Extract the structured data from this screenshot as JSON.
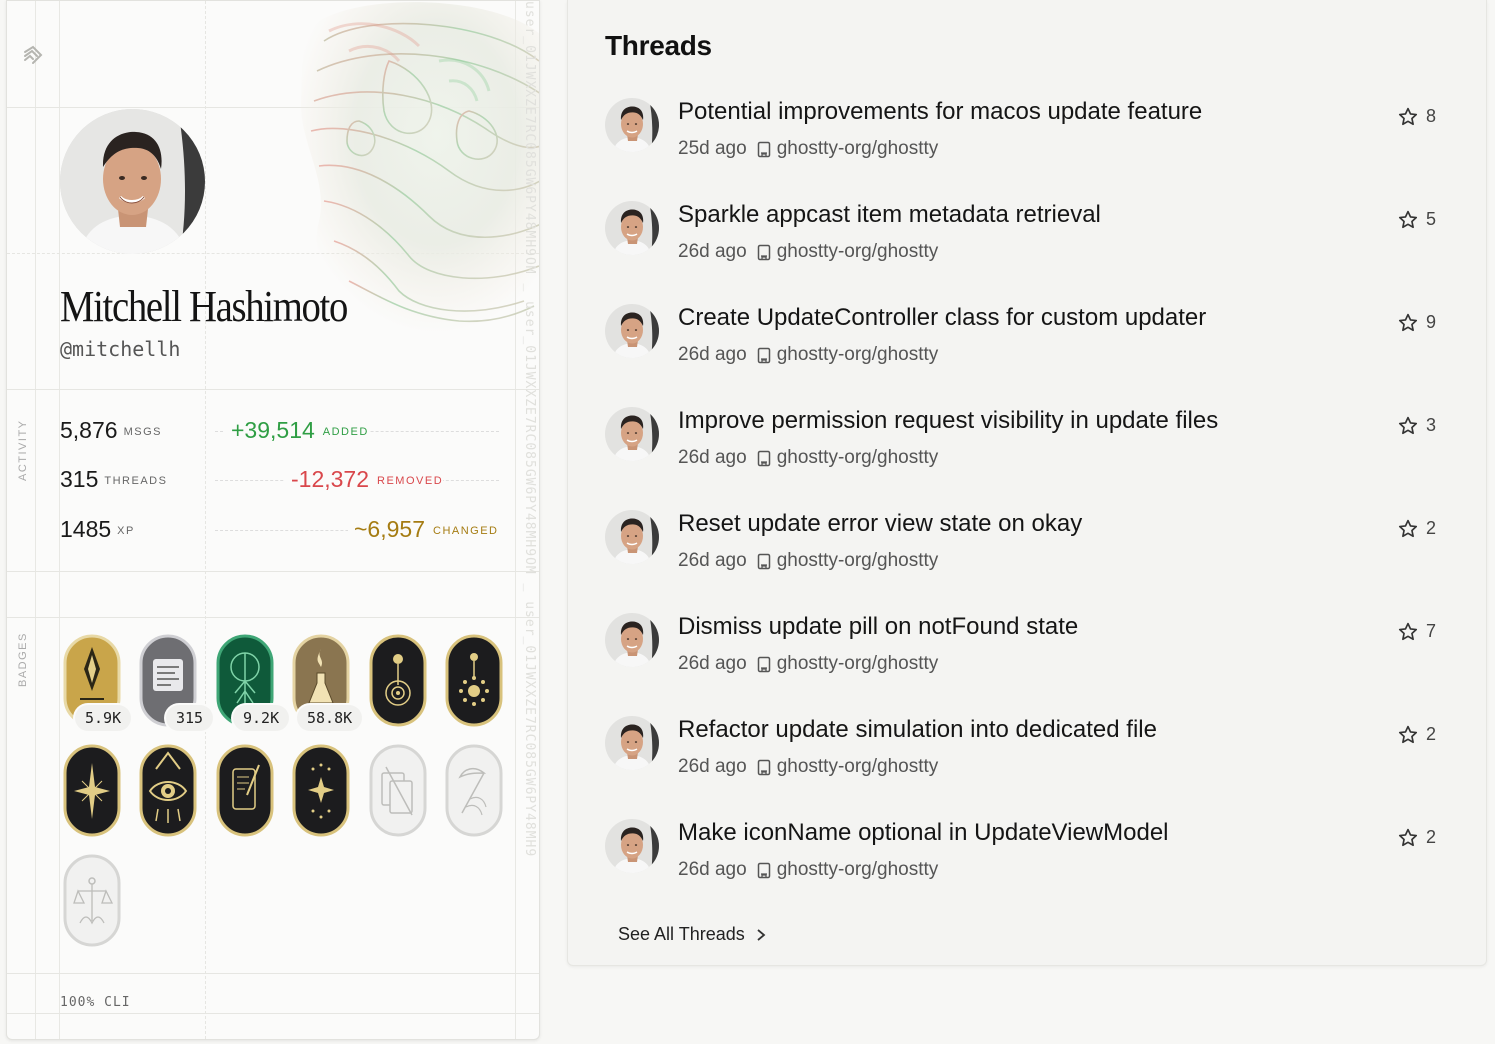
{
  "profile": {
    "name": "Mitchell Hashimoto",
    "handle": "@mitchellh",
    "user_id_text": "user_01JWXXZE7RC085GW6PY48MH9OM _ user_01JWXXZE7RC085GW6PY48MH9OM _ user_01JWXXZE7RC085GW6PY48MH9",
    "sections": {
      "activity": "ACTIVITY",
      "badges": "BADGES"
    },
    "stats": {
      "msgs": {
        "value": "5,876",
        "unit": "MSGS"
      },
      "threads": {
        "value": "315",
        "unit": "THREADS"
      },
      "xp": {
        "value": "1485",
        "unit": "XP"
      },
      "added": {
        "value": "+39,514",
        "unit": "ADDED",
        "color": "#2f9e44"
      },
      "removed": {
        "value": "-12,372",
        "unit": "REMOVED",
        "color": "#d9474b"
      },
      "changed": {
        "value": "~6,957",
        "unit": "CHANGED",
        "color": "#a57c12"
      }
    },
    "badges": [
      {
        "icon": "gold-quill-badge-icon",
        "count": "5.9K"
      },
      {
        "icon": "silver-terminal-badge-icon",
        "count": "315"
      },
      {
        "icon": "green-tree-badge-icon",
        "count": "9.2K"
      },
      {
        "icon": "gold-flask-badge-icon",
        "count": "58.8K"
      },
      {
        "icon": "black-orbit-badge-icon",
        "count": ""
      },
      {
        "icon": "black-sun-badge-icon",
        "count": ""
      },
      {
        "icon": "black-star-badge-icon",
        "count": ""
      },
      {
        "icon": "black-eye-badge-icon",
        "count": ""
      },
      {
        "icon": "black-scroll-badge-icon",
        "count": ""
      },
      {
        "icon": "black-moon-badge-icon",
        "count": ""
      },
      {
        "icon": "locked-cards-badge-icon",
        "count": ""
      },
      {
        "icon": "locked-scythe-badge-icon",
        "count": ""
      },
      {
        "icon": "locked-scales-badge-icon",
        "count": ""
      }
    ],
    "cli": "100% CLI"
  },
  "threads": {
    "title": "Threads",
    "items": [
      {
        "title": "Potential improvements for macos update feature",
        "age": "25d ago",
        "repo": "ghostty-org/ghostty",
        "stars": "8"
      },
      {
        "title": "Sparkle appcast item metadata retrieval",
        "age": "26d ago",
        "repo": "ghostty-org/ghostty",
        "stars": "5"
      },
      {
        "title": "Create UpdateController class for custom updater",
        "age": "26d ago",
        "repo": "ghostty-org/ghostty",
        "stars": "9"
      },
      {
        "title": "Improve permission request visibility in update files",
        "age": "26d ago",
        "repo": "ghostty-org/ghostty",
        "stars": "3"
      },
      {
        "title": "Reset update error view state on okay",
        "age": "26d ago",
        "repo": "ghostty-org/ghostty",
        "stars": "2"
      },
      {
        "title": "Dismiss update pill on notFound state",
        "age": "26d ago",
        "repo": "ghostty-org/ghostty",
        "stars": "7"
      },
      {
        "title": "Refactor update simulation into dedicated file",
        "age": "26d ago",
        "repo": "ghostty-org/ghostty",
        "stars": "2"
      },
      {
        "title": "Make iconName optional in UpdateViewModel",
        "age": "26d ago",
        "repo": "ghostty-org/ghostty",
        "stars": "2"
      }
    ],
    "see_all": "See All Threads"
  }
}
